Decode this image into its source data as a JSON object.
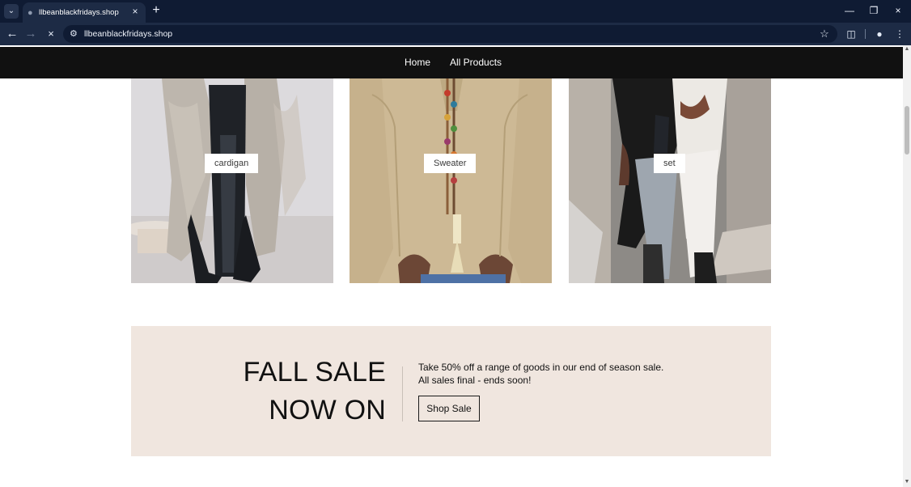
{
  "browser": {
    "tab_title": "llbeanblackfridays.shop",
    "url": "llbeanblackfridays.shop"
  },
  "site": {
    "nav": [
      {
        "label": "Home"
      },
      {
        "label": "All Products"
      }
    ]
  },
  "collections": [
    {
      "label": "cardigan"
    },
    {
      "label": "Sweater"
    },
    {
      "label": "set"
    }
  ],
  "promo": {
    "title_line1": "FALL SALE",
    "title_line2": "NOW ON",
    "text_line1": "Take 50% off a range of goods in our end of season sale.",
    "text_line2": "All sales final - ends soon!",
    "button_label": "Shop Sale"
  },
  "icons": {
    "tab_menu": "chevron-down-icon",
    "tab_favicon": "site-icon",
    "close_tab": "close-icon",
    "new_tab": "plus-icon",
    "back": "back-arrow-icon",
    "forward": "forward-arrow-icon",
    "stop": "close-icon",
    "site_info": "settings-icon",
    "bookmark": "star-icon",
    "extensions": "puzzle-icon",
    "profile": "profile-icon",
    "menu": "more-vertical-icon"
  },
  "colors": {
    "chrome_bg": "#0f1b33",
    "toolbar_bg": "#1d2b45",
    "site_nav_bg": "#111111",
    "promo_bg": "#f0e6df"
  }
}
